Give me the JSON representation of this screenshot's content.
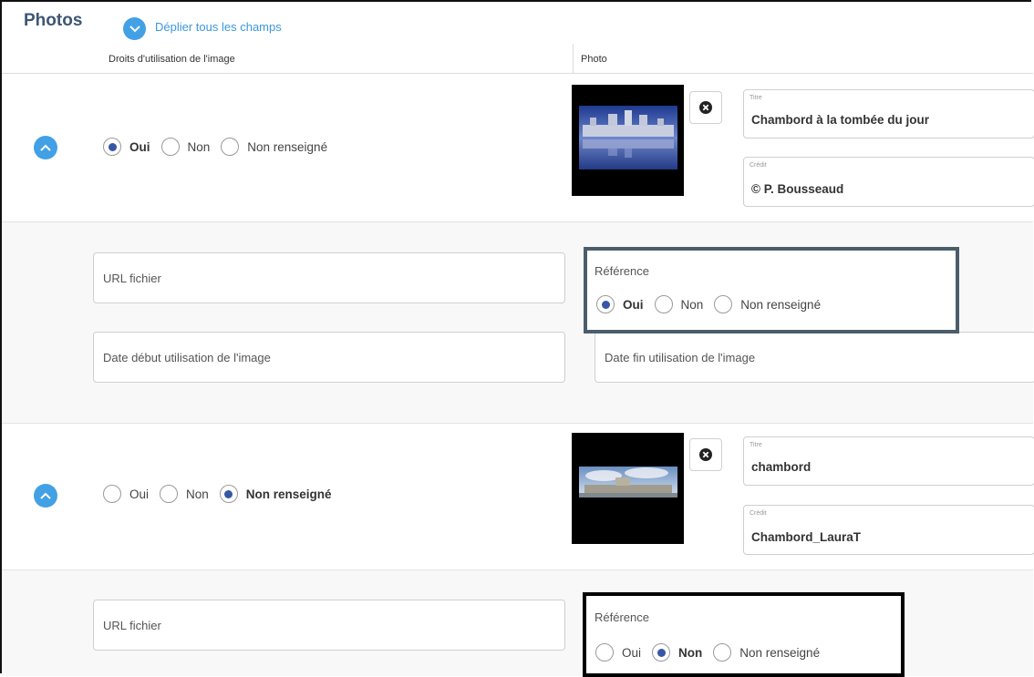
{
  "header": {
    "title": "Photos",
    "expand_all_label": "Déplier tous les champs"
  },
  "columns": {
    "rights": "Droits d'utilisation de l'image",
    "photo": "Photo"
  },
  "radio_options": [
    "Oui",
    "Non",
    "Non renseigné"
  ],
  "photos": [
    {
      "rights_selected": "Oui",
      "title_label": "Titre",
      "title_value": "Chambord à la tombée du jour",
      "credit_label": "Crédit",
      "credit_value": "© P. Bousseaud",
      "url_placeholder": "URL fichier",
      "reference_label": "Référence",
      "reference_selected": "Oui",
      "date_start_placeholder": "Date début utilisation de l'image",
      "date_end_placeholder": "Date fin utilisation de l'image"
    },
    {
      "rights_selected": "Non renseigné",
      "title_label": "Titre",
      "title_value": "chambord",
      "credit_label": "Crédit",
      "credit_value": "Chambord_LauraT",
      "url_placeholder": "URL fichier",
      "reference_label": "Référence",
      "reference_selected": "Non"
    }
  ],
  "colors": {
    "accent": "#42a0e5",
    "title": "#3d5675",
    "radio_selected": "#3657a7",
    "highlight_box_1": "#4b5d6b",
    "highlight_box_2": "#000000"
  }
}
